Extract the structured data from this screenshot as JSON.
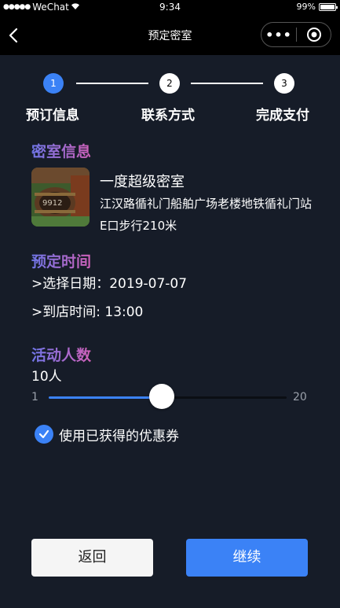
{
  "status_bar": {
    "signal": "●●●●●",
    "carrier": "WeChat",
    "time": "9:34",
    "battery_pct": "99%",
    "battery_level": 0.99
  },
  "nav": {
    "title": "预定密室"
  },
  "steps": [
    {
      "num": "1",
      "label": "预订信息",
      "active": true
    },
    {
      "num": "2",
      "label": "联系方式",
      "active": false
    },
    {
      "num": "3",
      "label": "完成支付",
      "active": false
    }
  ],
  "room": {
    "section_title": "密室信息",
    "thumb_text": "9912",
    "name": "一度超级密室",
    "address": "江汉路循礼门船舶广场老楼地铁循礼门站E口步行210米"
  },
  "schedule": {
    "section_title": "预定时间",
    "date_line": ">选择日期：2019-07-07",
    "time_line": ">到店时间: 13:00"
  },
  "people": {
    "section_title": "活动人数",
    "value_label": "10人",
    "min": "1",
    "max": "20",
    "value": 10
  },
  "coupon": {
    "label": "使用已获得的优惠券",
    "checked": true
  },
  "buttons": {
    "back": "返回",
    "next": "继续"
  },
  "colors": {
    "accent": "#3b82f6",
    "background": "#161c28"
  }
}
